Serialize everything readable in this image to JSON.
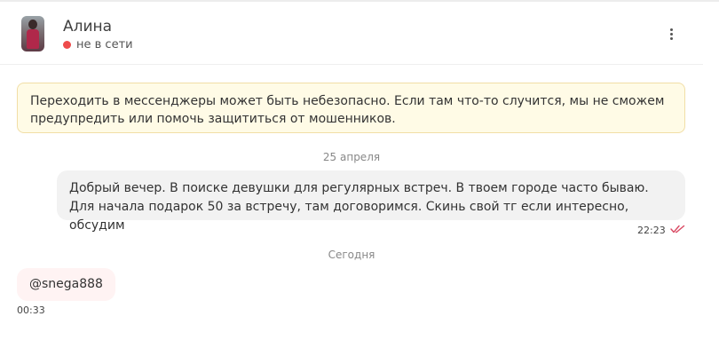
{
  "contact": {
    "name": "Алина",
    "status": "не в сети"
  },
  "warning": {
    "text": "Переходить в мессенджеры может быть небезопасно. Если там что-то случится, мы не сможем предупредить или помочь защититься от мошенников."
  },
  "messages": [
    {
      "date": "25 апреля",
      "direction": "outgoing",
      "text": "Добрый вечер. В поиске девушки для регулярных встреч. В твоем городе часто бываю. Для начала подарок 50 за встречу, там договоримся. Скинь свой тг если интересно, обсудим",
      "time": "22:23",
      "read": true
    },
    {
      "date": "Сегодня",
      "direction": "incoming",
      "text": "@snega888",
      "time": "00:33"
    }
  ],
  "colors": {
    "status_offline": "#ee4b4b",
    "read_checks": "#d94a63",
    "warning_bg": "#fffbe6"
  },
  "icons": {
    "menu": "more-vertical-icon",
    "read": "double-check-icon"
  }
}
